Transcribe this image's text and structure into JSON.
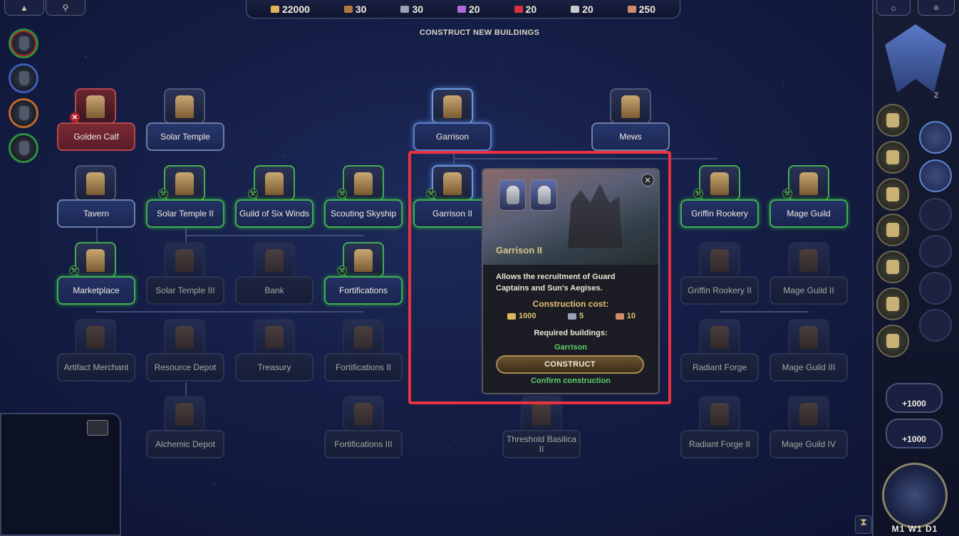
{
  "top_resources": [
    {
      "name": "gold",
      "value": "22000",
      "color": "#e0b45a"
    },
    {
      "name": "wood",
      "value": "30",
      "color": "#b07840"
    },
    {
      "name": "ore",
      "value": "30",
      "color": "#9aa0b8"
    },
    {
      "name": "crystals",
      "value": "20",
      "color": "#b06ad8"
    },
    {
      "name": "gems",
      "value": "20",
      "color": "#d8323c"
    },
    {
      "name": "mercury",
      "value": "20",
      "color": "#c8c8d0"
    },
    {
      "name": "dust",
      "value": "250",
      "color": "#d08a6a"
    }
  ],
  "top_left_buttons": {
    "collapse_icon": "▲",
    "location_icon": "⚲"
  },
  "page_title": "CONSTRUCT NEW BUILDINGS",
  "buildings": {
    "golden_calf": "Golden Calf",
    "solar_temple": "Solar Temple",
    "garrison": "Garrison",
    "mews": "Mews",
    "tavern": "Tavern",
    "solar_temple_2": "Solar Temple II",
    "guild_six_winds": "Guild of Six Winds",
    "scouting_skyship": "Scouting Skyship",
    "garrison_2": "Garrison II",
    "griffin_rookery": "Griffin Rookery",
    "mage_guild": "Mage Guild",
    "marketplace": "Marketplace",
    "solar_temple_3": "Solar Temple III",
    "bank": "Bank",
    "fortifications": "Fortifications",
    "griffin_rookery_2": "Griffin Rookery II",
    "mage_guild_2": "Mage Guild II",
    "artifact_merchant": "Artifact Merchant",
    "resource_depot": "Resource Depot",
    "treasury": "Treasury",
    "fortifications_2": "Fortifications II",
    "radiant_forge": "Radiant Forge",
    "mage_guild_3": "Mage Guild III",
    "alchemic_depot": "Alchemic Depot",
    "fortifications_3": "Fortifications III",
    "threshold_basilica_2": "Threshold Basilica II",
    "radiant_forge_2": "Radiant Forge II",
    "mage_guild_4": "Mage Guild IV"
  },
  "popup": {
    "title": "Garrison II",
    "description": "Allows the recruitment of Guard Captains and Sun's Aegises.",
    "cost_heading": "Construction cost:",
    "costs": [
      {
        "resource": "gold",
        "value": "1000",
        "color": "#e0b45a"
      },
      {
        "resource": "ore",
        "value": "5",
        "color": "#9aa0b8"
      },
      {
        "resource": "dust",
        "value": "10",
        "color": "#d08a6a"
      }
    ],
    "required_heading": "Required buildings:",
    "required_value": "Garrison",
    "construct_label": "CONSTRUCT",
    "confirm_label": "Confirm construction",
    "close_icon": "✕"
  },
  "right_panel": {
    "badge_count": "2",
    "plus_gold": "+1000",
    "plus_other": "+1000",
    "date": "M1  W1  D1"
  },
  "colors": {
    "highlight": "#e8333f",
    "available": "#3fae52",
    "confirm_green": "#5fd06b",
    "gold_text": "#e2c070"
  }
}
